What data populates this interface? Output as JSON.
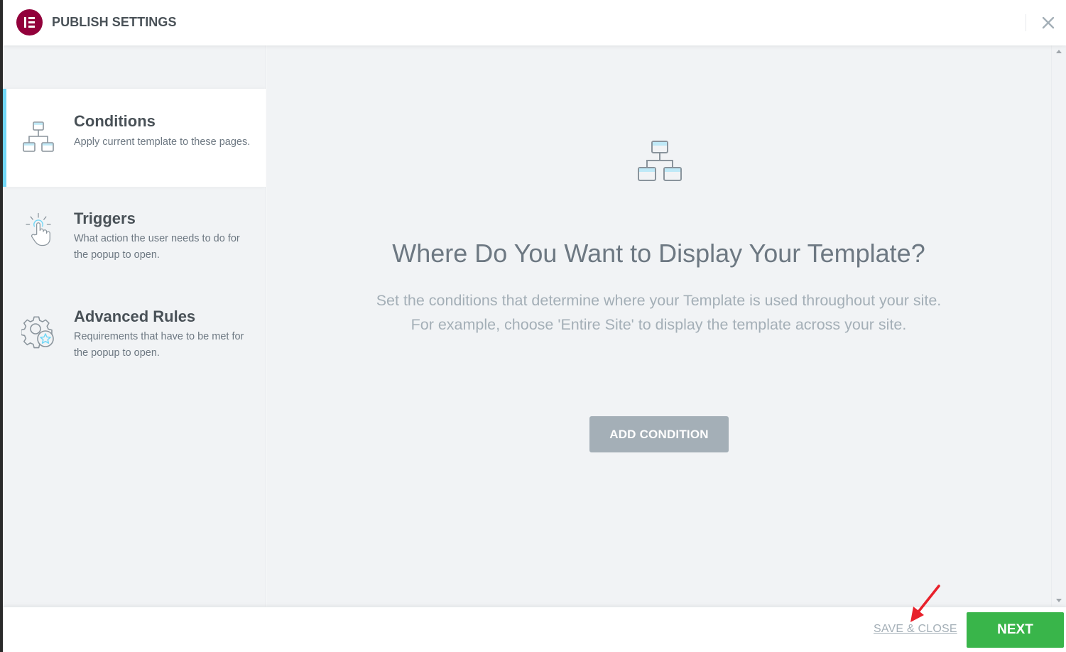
{
  "header": {
    "title": "PUBLISH SETTINGS",
    "logo_icon": "elementor-logo-icon",
    "close_icon": "close-icon"
  },
  "sidebar": {
    "items": [
      {
        "title": "Conditions",
        "description": "Apply current template to these pages.",
        "icon": "sitemap-icon",
        "active": true
      },
      {
        "title": "Triggers",
        "description": "What action the user needs to do for the popup to open.",
        "icon": "pointer-hand-icon",
        "active": false
      },
      {
        "title": "Advanced Rules",
        "description": "Requirements that have to be met for the popup to open.",
        "icon": "gear-star-icon",
        "active": false
      }
    ]
  },
  "main": {
    "icon": "sitemap-icon",
    "title": "Where Do You Want to Display Your Template?",
    "description_line1": "Set the conditions that determine where your Template is used throughout your site.",
    "description_line2": "For example, choose 'Entire Site' to display the template across your site.",
    "add_button_label": "ADD CONDITION"
  },
  "footer": {
    "save_close_label": "SAVE & CLOSE",
    "next_label": "NEXT"
  },
  "colors": {
    "brand": "#92003b",
    "accent": "#71d7f7",
    "next": "#39b54a",
    "muted_button": "#a4afb7",
    "annotation_arrow": "#e8212b"
  }
}
